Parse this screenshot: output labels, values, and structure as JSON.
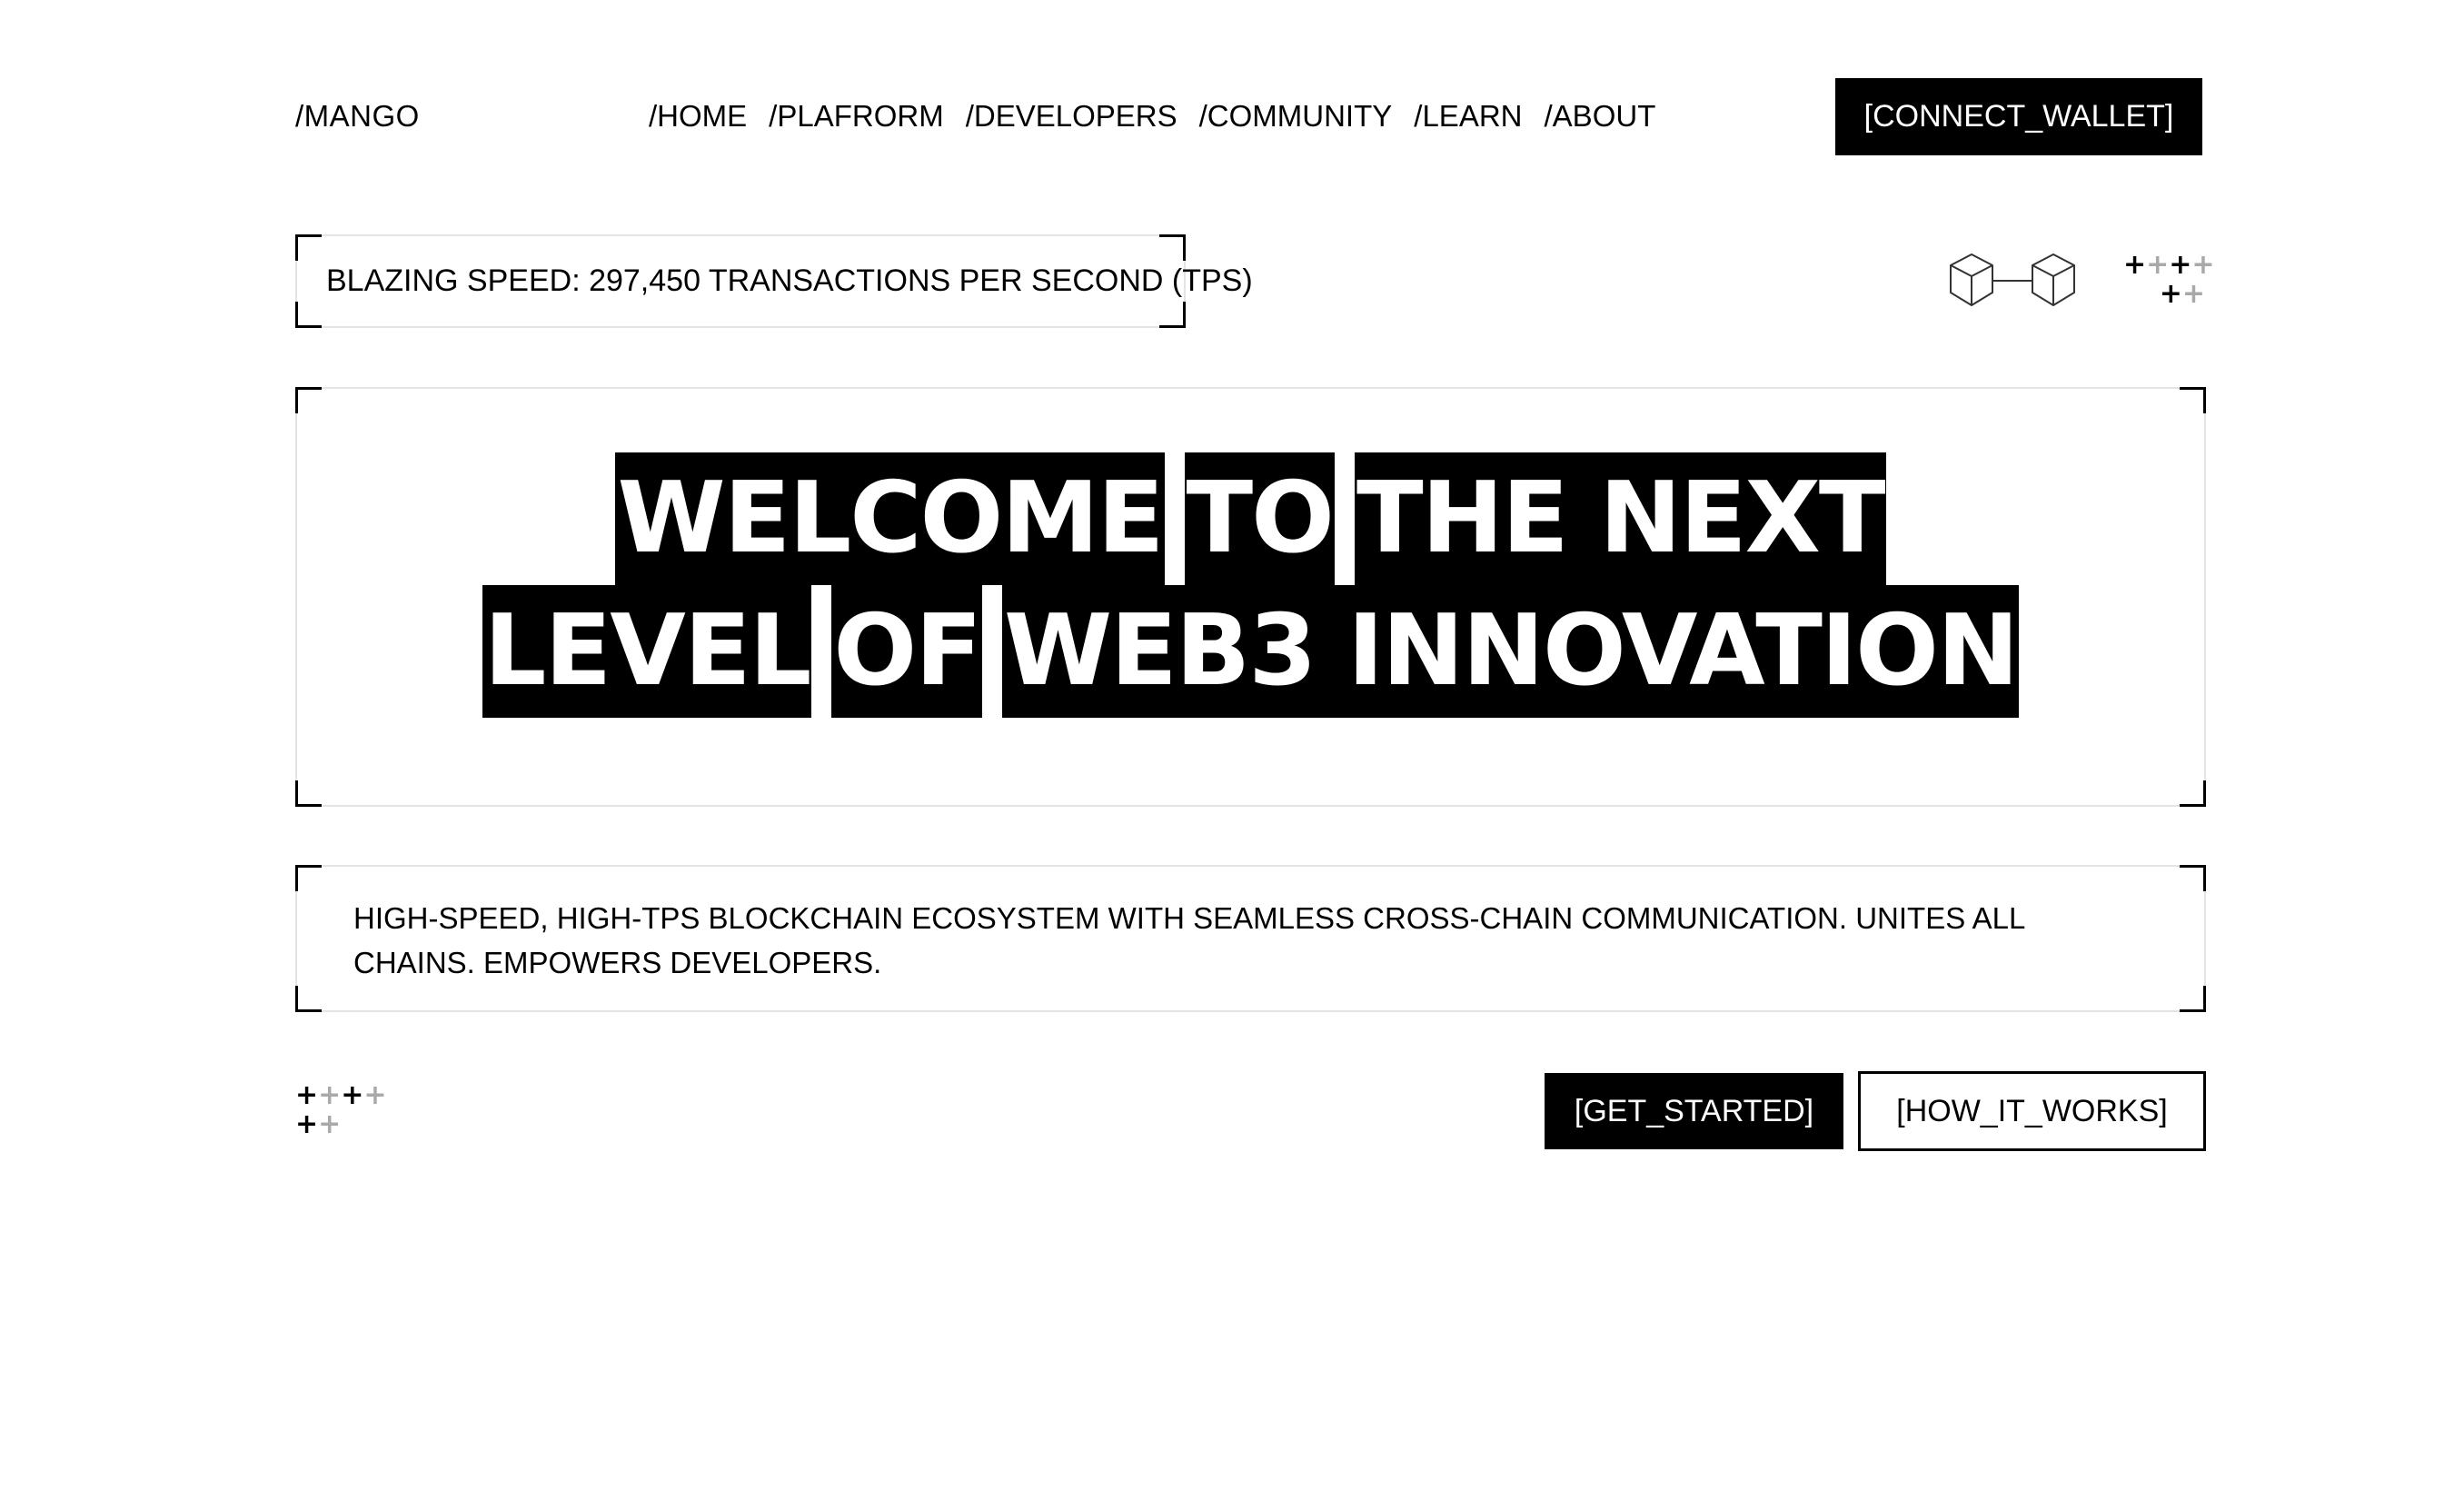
{
  "header": {
    "logo": "/MANGO",
    "nav": [
      "/HOME",
      "/PLAFRORM",
      "/DEVELOPERS",
      "/COMMUNITY",
      "/LEARN",
      "/ABOUT"
    ],
    "connect_wallet_label": "[CONNECT_WALLET]"
  },
  "stats": {
    "speed_text": "BLAZING SPEED: 297,450 TRANSACTIONS PER SECOND (TPS)"
  },
  "decor": {
    "cubes_icon": "linked-cubes-icon",
    "plus_glyph": "+"
  },
  "hero": {
    "line1": [
      "WELCOME",
      "TO",
      "THE NEXT"
    ],
    "line2": [
      "LEVEL",
      "OF",
      "WEB3 INNOVATION"
    ]
  },
  "description": {
    "text": "HIGH-SPEED, HIGH-TPS BLOCKCHAIN ECOSYSTEM WITH SEAMLESS CROSS-CHAIN COMMUNICATION. UNITES ALL CHAINS. EMPOWERS DEVELOPERS."
  },
  "cta": {
    "get_started_label": "[GET_STARTED]",
    "how_it_works_label": "[HOW_IT_WORKS]"
  },
  "colors": {
    "primary": "#000000",
    "background": "#ffffff",
    "border_light": "#e4e4e4",
    "plus_light": "#a9a9a9"
  }
}
